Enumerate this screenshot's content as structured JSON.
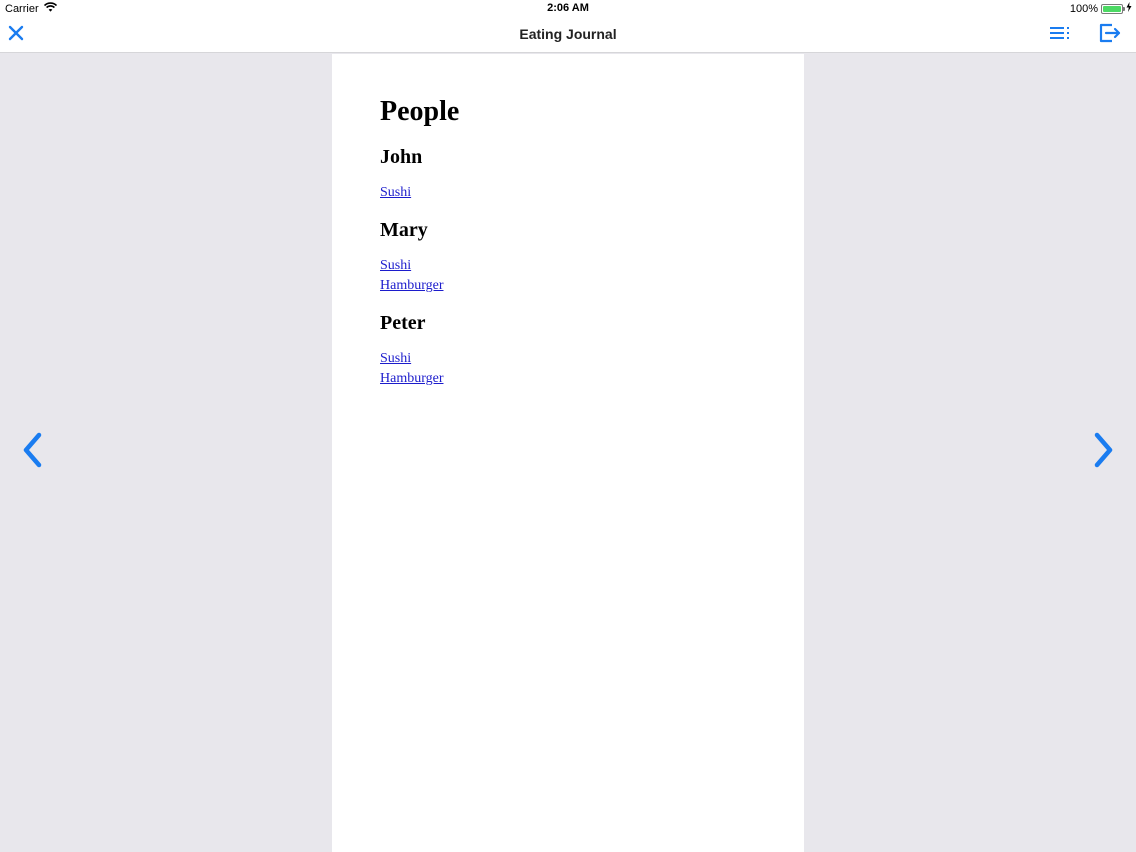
{
  "status_bar": {
    "carrier": "Carrier",
    "time": "2:06 AM",
    "battery": "100%"
  },
  "nav": {
    "title": "Eating Journal"
  },
  "document": {
    "heading": "People",
    "people": [
      {
        "name": "John",
        "links": [
          "Sushi"
        ]
      },
      {
        "name": "Mary",
        "links": [
          "Sushi",
          "Hamburger"
        ]
      },
      {
        "name": "Peter",
        "links": [
          "Sushi",
          "Hamburger"
        ]
      }
    ]
  },
  "colors": {
    "accent": "#1a7cf0",
    "link": "#1c1ccc",
    "side_background": "#e8e7ec"
  }
}
